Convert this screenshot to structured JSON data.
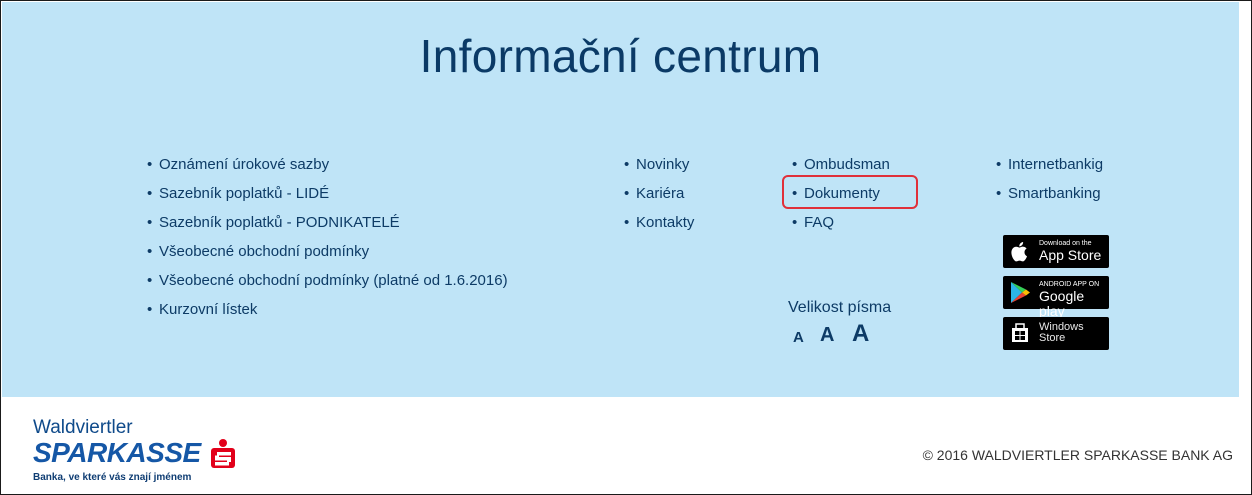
{
  "info": {
    "heading": "Informační centrum",
    "column1": [
      "Oznámení úrokové sazby",
      "Sazebník poplatků - LIDÉ",
      "Sazebník poplatků - PODNIKATELÉ",
      "Všeobecné obchodní podmínky",
      "Všeobecné obchodní podmínky (platné od 1.6.2016)",
      "Kurzovní lístek"
    ],
    "column2": [
      "Novinky",
      "Kariéra",
      "Kontakty"
    ],
    "column3": [
      "Ombudsman",
      "Dokumenty",
      "FAQ"
    ],
    "column4": [
      "Internetbankig",
      "Smartbanking"
    ],
    "bullet": "•",
    "stores": {
      "appstore_small": "Download on the",
      "appstore_big": "App Store",
      "googleplay_small": "ANDROID APP ON",
      "googleplay_big": "Google play",
      "windows_line1": "Windows",
      "windows_line2": "Store"
    },
    "font_size": {
      "label": "Velikost písma",
      "small": "A",
      "medium": "A",
      "large": "A"
    }
  },
  "footer": {
    "logo_top": "Waldviertler",
    "logo_brand": "SPARKASSE",
    "logo_tagline": "Banka, ve které vás znají jménem",
    "copyright": "© 2016 WALDVIERTLER SPARKASSE BANK AG"
  },
  "colors": {
    "panel_bg": "#bfe4f7",
    "link_text": "#0d3b66",
    "highlight_border": "#e0303a",
    "brand_blue": "#1557a6",
    "brand_red": "#e2001a"
  }
}
